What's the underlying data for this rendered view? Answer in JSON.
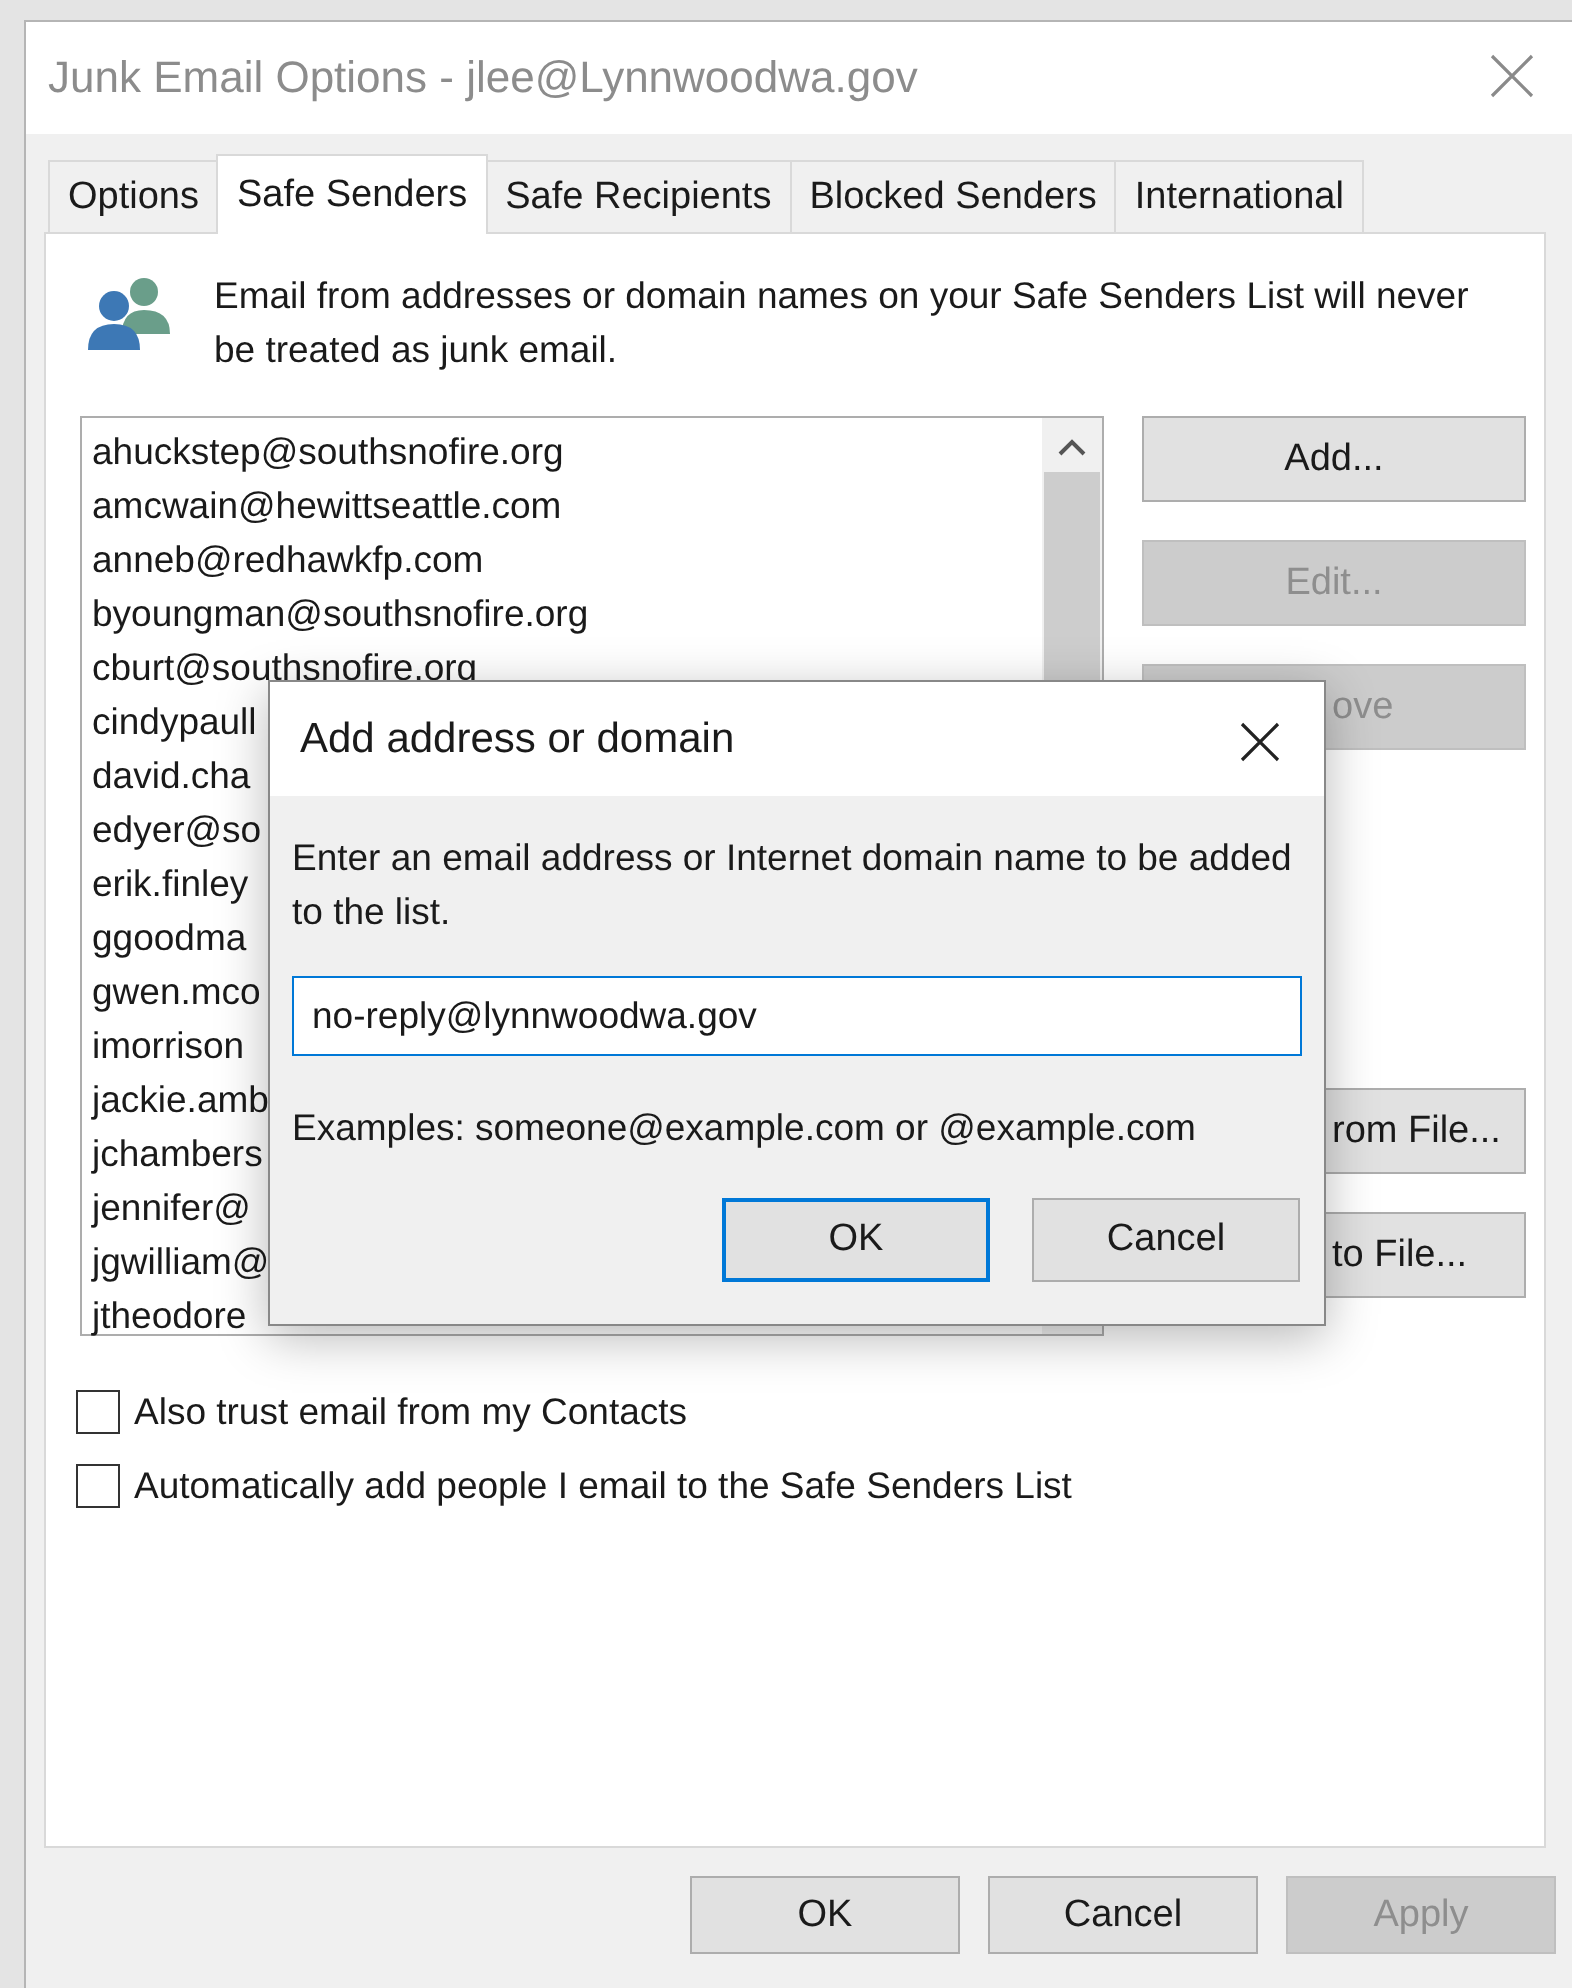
{
  "window": {
    "title": "Junk Email Options - jlee@Lynnwoodwa.gov"
  },
  "tabs": [
    {
      "label": "Options",
      "selected": false
    },
    {
      "label": "Safe Senders",
      "selected": true
    },
    {
      "label": "Safe Recipients",
      "selected": false
    },
    {
      "label": "Blocked Senders",
      "selected": false
    },
    {
      "label": "International",
      "selected": false
    }
  ],
  "info": "Email from addresses or domain names on your Safe Senders List will never be treated as junk email.",
  "safe_senders": [
    "ahuckstep@southsnofire.org",
    "amcwain@hewittseattle.com",
    "anneb@redhawkfp.com",
    "byoungman@southsnofire.org",
    "cburt@southsnofire.org",
    "cindypaull",
    "david.cha",
    "edyer@so",
    "erik.finley",
    "ggoodma",
    "gwen.mco",
    "imorrison",
    "jackie.amb",
    "jchambers",
    "jennifer@",
    "jgwilliam@",
    "jtheodore"
  ],
  "side_buttons": [
    {
      "label": "Add...",
      "disabled": false,
      "kind": "full"
    },
    {
      "label": "Edit...",
      "disabled": true,
      "kind": "full"
    },
    {
      "label": "ove",
      "disabled": true,
      "kind": "partial"
    },
    {
      "kind": "spacer"
    },
    {
      "label": "rom File...",
      "disabled": false,
      "kind": "partial"
    },
    {
      "label": "to File...",
      "disabled": false,
      "kind": "partial"
    }
  ],
  "options": [
    {
      "label": "Also trust email from my Contacts",
      "checked": false
    },
    {
      "label": "Automatically add people I email to the Safe Senders List",
      "checked": false
    }
  ],
  "footer_buttons": [
    {
      "label": "OK",
      "disabled": false
    },
    {
      "label": "Cancel",
      "disabled": false
    },
    {
      "label": "Apply",
      "disabled": true
    }
  ],
  "dialog": {
    "title": "Add address or domain",
    "prompt": "Enter an email address or Internet domain name to be added to the list.",
    "value": "no-reply@lynnwoodwa.gov",
    "examples": "Examples: someone@example.com or @example.com",
    "buttons": [
      {
        "label": "OK",
        "focused": true
      },
      {
        "label": "Cancel",
        "focused": false
      }
    ]
  }
}
